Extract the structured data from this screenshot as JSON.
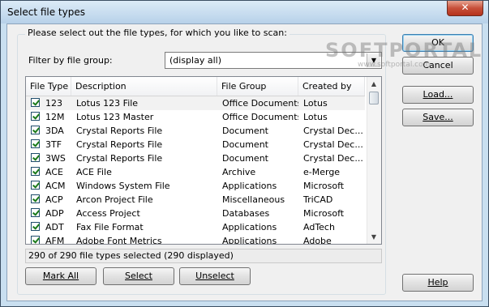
{
  "window": {
    "title": "Select file types",
    "close_glyph": "✕"
  },
  "group": {
    "legend": "Please select out the file types, for which you like to scan:"
  },
  "filter": {
    "label": "Filter by file group:",
    "value": "(display all)"
  },
  "list": {
    "columns": [
      "File Type",
      "Description",
      "File Group",
      "Created by"
    ],
    "rows": [
      {
        "type": "123",
        "desc": "Lotus 123 File",
        "group": "Office Documents",
        "by": "Lotus"
      },
      {
        "type": "12M",
        "desc": "Lotus 123 Master",
        "group": "Office Documents",
        "by": "Lotus"
      },
      {
        "type": "3DA",
        "desc": "Crystal Reports File",
        "group": "Document",
        "by": "Crystal Dec..."
      },
      {
        "type": "3TF",
        "desc": "Crystal Reports File",
        "group": "Document",
        "by": "Crystal Dec..."
      },
      {
        "type": "3WS",
        "desc": "Crystal Reports File",
        "group": "Document",
        "by": "Crystal Dec..."
      },
      {
        "type": "ACE",
        "desc": "ACE File",
        "group": "Archive",
        "by": "e-Merge"
      },
      {
        "type": "ACM",
        "desc": "Windows System File",
        "group": "Applications",
        "by": "Microsoft"
      },
      {
        "type": "ACP",
        "desc": "Arcon Project File",
        "group": "Miscellaneous",
        "by": "TriCAD"
      },
      {
        "type": "ADP",
        "desc": "Access Project",
        "group": "Databases",
        "by": "Microsoft"
      },
      {
        "type": "ADT",
        "desc": "Fax File Format",
        "group": "Applications",
        "by": "AdTech"
      },
      {
        "type": "AFM",
        "desc": "Adobe Font Metrics",
        "group": "Applications",
        "by": "Adobe"
      }
    ]
  },
  "status": "290 of 290 file types selected (290 displayed)",
  "buttons": {
    "mark_all": "Mark All",
    "select": "Select",
    "unselect": "Unselect",
    "ok": "OK",
    "cancel": "Cancel",
    "load": "Load...",
    "save": "Save...",
    "help": "Help"
  },
  "watermark": {
    "main": "SOFTPORTAL",
    "sub": "www.softportal.com"
  },
  "colors": {
    "check": "#1a7a1a",
    "title_bg": "#c9dff0",
    "close": "#c7503a"
  }
}
